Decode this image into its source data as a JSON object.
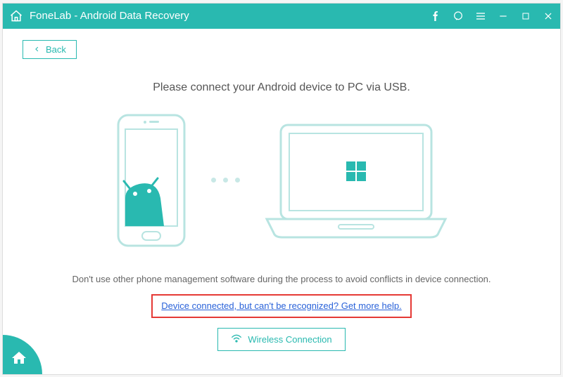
{
  "app": {
    "title": "FoneLab - Android Data Recovery"
  },
  "toolbar": {
    "back_label": "Back"
  },
  "main": {
    "instruction": "Please connect your Android device to PC via USB.",
    "warning": "Don't use other phone management software during the process to avoid conflicts in device connection.",
    "help_link": "Device connected, but can't be recognized? Get more help.",
    "wireless_label": "Wireless Connection"
  },
  "colors": {
    "accent": "#29b9b0",
    "link": "#2962d9",
    "highlight_border": "#e53935"
  }
}
